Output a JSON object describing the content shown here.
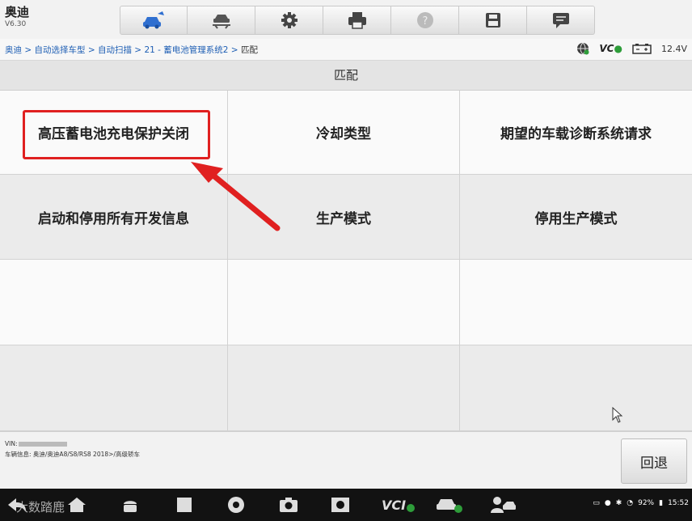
{
  "brand": {
    "name": "奥迪",
    "version": "V6.30"
  },
  "toolbar": {
    "buttons": [
      {
        "icon": "home-car-icon",
        "active": true
      },
      {
        "icon": "vehicle-lift-icon",
        "active": false
      },
      {
        "icon": "settings-gear-icon",
        "active": false
      },
      {
        "icon": "printer-icon",
        "active": false
      },
      {
        "icon": "help-icon",
        "active": false
      },
      {
        "icon": "save-icon",
        "active": false
      },
      {
        "icon": "message-icon",
        "active": false
      }
    ]
  },
  "breadcrumb": {
    "items": [
      "奥迪",
      "自动选择车型",
      "自动扫描",
      "21 - 蓄电池管理系统2"
    ],
    "current": "匹配",
    "separator": " > "
  },
  "status": {
    "vci_label": "VC",
    "voltage": "12.4V"
  },
  "page_title": "匹配",
  "functions": [
    "高压蓄电池充电保护关闭",
    "冷却类型",
    "期望的车载诊断系统请求",
    "启动和停用所有开发信息",
    "生产模式",
    "停用生产模式",
    "",
    "",
    "",
    "",
    "",
    ""
  ],
  "footer": {
    "vin_label": "VIN:",
    "car_info": "车辆信息: 奥迪/奥迪A8/S8/RS8 2018>/高级轿车",
    "back_label": "回退"
  },
  "system_tray": {
    "battery": "92%",
    "time": "15:52"
  },
  "watermark": "大数踏鹿",
  "colors": {
    "highlight": "#e02020",
    "link": "#1f5fb4",
    "toolbar_active": "#2f6fd0"
  }
}
